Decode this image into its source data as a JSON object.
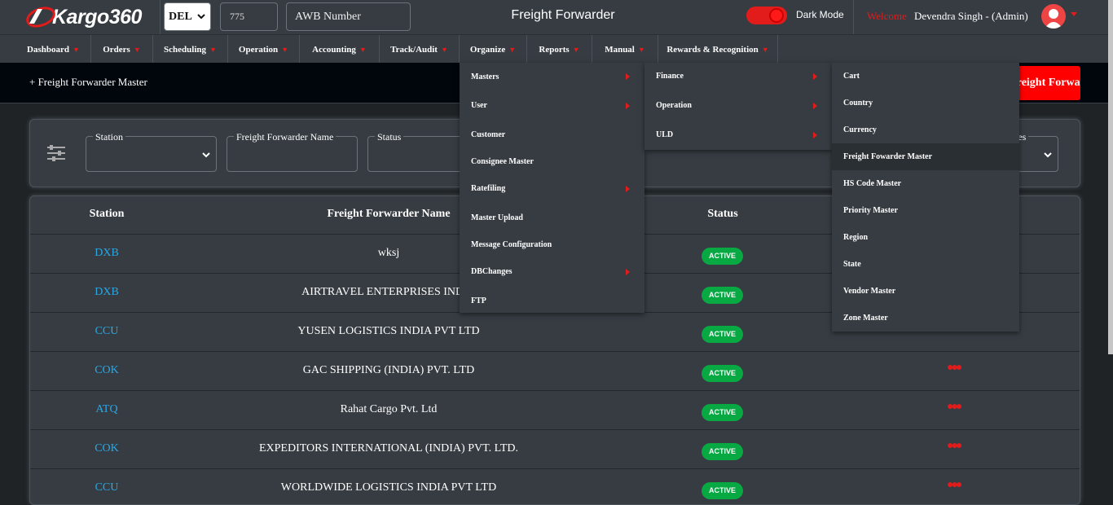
{
  "app": {
    "logo_text": "Kargo360",
    "title": "Freight Forwarder",
    "station": "DEL",
    "awb_prefix": "775",
    "awb_placeholder": "AWB Number",
    "dark_mode_label": "Dark Mode",
    "dark_mode_on": true,
    "welcome_label": "Welcome",
    "user_name": "Devendra Singh - (Admin)"
  },
  "nav": [
    "Dashboard",
    "Orders",
    "Scheduling",
    "Operation",
    "Accounting",
    "Track/Audit",
    "Organize",
    "Reports",
    "Manual",
    "Rewards & Recognition"
  ],
  "page": {
    "breadcrumb": "+ Freight Forwarder Master",
    "add_button": "Add Freight Forwarder"
  },
  "filters": {
    "station_label": "Station",
    "name_label": "Freight Forwarder Name",
    "status_label": "Status",
    "fourth_label_tail": "ries"
  },
  "table": {
    "headers": {
      "station": "Station",
      "name": "Freight Forwarder Name",
      "status": "Status"
    },
    "rows": [
      {
        "station": "DXB",
        "name": "wksj",
        "status": "ACTIVE"
      },
      {
        "station": "DXB",
        "name": "AIRTRAVEL ENTERPRISES INDIA",
        "status": "ACTIVE"
      },
      {
        "station": "CCU",
        "name": "YUSEN LOGISTICS INDIA PVT LTD",
        "status": "ACTIVE"
      },
      {
        "station": "COK",
        "name": "GAC SHIPPING (INDIA) PVT. LTD",
        "status": "ACTIVE"
      },
      {
        "station": "ATQ",
        "name": "Rahat Cargo Pvt. Ltd",
        "status": "ACTIVE"
      },
      {
        "station": "COK",
        "name": "EXPEDITORS INTERNATIONAL (INDIA) PVT. LTD.",
        "status": "ACTIVE"
      },
      {
        "station": "CCU",
        "name": "WORLDWIDE LOGISTICS INDIA PVT LTD",
        "status": "ACTIVE"
      }
    ],
    "actions_glyph": "●●●"
  },
  "organize_menu": [
    "Masters",
    "User",
    "Customer",
    "Consignee Master",
    "Ratefiling",
    "Master Upload",
    "Message Configuration",
    "DBChanges",
    "FTP"
  ],
  "masters_menu": [
    "Finance",
    "Operation",
    "ULD"
  ],
  "operation_menu": [
    "Cart",
    "Country",
    "Currency",
    "Freight Fowarder Master",
    "HS Code Master",
    "Priority Master",
    "Region",
    "State",
    "Vendor Master",
    "Zone Master"
  ],
  "colors": {
    "accent": "#e21b1b",
    "link": "#2aa8e6",
    "active_badge": "#08a843",
    "panel": "#363c42"
  }
}
